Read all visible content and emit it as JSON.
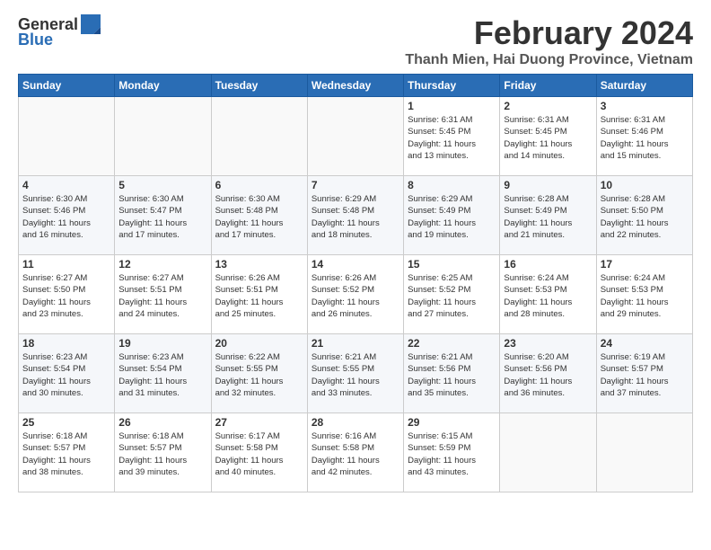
{
  "logo": {
    "text_general": "General",
    "text_blue": "Blue"
  },
  "header": {
    "title": "February 2024",
    "location": "Thanh Mien, Hai Duong Province, Vietnam"
  },
  "columns": [
    "Sunday",
    "Monday",
    "Tuesday",
    "Wednesday",
    "Thursday",
    "Friday",
    "Saturday"
  ],
  "weeks": [
    [
      {
        "day": "",
        "info": ""
      },
      {
        "day": "",
        "info": ""
      },
      {
        "day": "",
        "info": ""
      },
      {
        "day": "",
        "info": ""
      },
      {
        "day": "1",
        "info": "Sunrise: 6:31 AM\nSunset: 5:45 PM\nDaylight: 11 hours\nand 13 minutes."
      },
      {
        "day": "2",
        "info": "Sunrise: 6:31 AM\nSunset: 5:45 PM\nDaylight: 11 hours\nand 14 minutes."
      },
      {
        "day": "3",
        "info": "Sunrise: 6:31 AM\nSunset: 5:46 PM\nDaylight: 11 hours\nand 15 minutes."
      }
    ],
    [
      {
        "day": "4",
        "info": "Sunrise: 6:30 AM\nSunset: 5:46 PM\nDaylight: 11 hours\nand 16 minutes."
      },
      {
        "day": "5",
        "info": "Sunrise: 6:30 AM\nSunset: 5:47 PM\nDaylight: 11 hours\nand 17 minutes."
      },
      {
        "day": "6",
        "info": "Sunrise: 6:30 AM\nSunset: 5:48 PM\nDaylight: 11 hours\nand 17 minutes."
      },
      {
        "day": "7",
        "info": "Sunrise: 6:29 AM\nSunset: 5:48 PM\nDaylight: 11 hours\nand 18 minutes."
      },
      {
        "day": "8",
        "info": "Sunrise: 6:29 AM\nSunset: 5:49 PM\nDaylight: 11 hours\nand 19 minutes."
      },
      {
        "day": "9",
        "info": "Sunrise: 6:28 AM\nSunset: 5:49 PM\nDaylight: 11 hours\nand 21 minutes."
      },
      {
        "day": "10",
        "info": "Sunrise: 6:28 AM\nSunset: 5:50 PM\nDaylight: 11 hours\nand 22 minutes."
      }
    ],
    [
      {
        "day": "11",
        "info": "Sunrise: 6:27 AM\nSunset: 5:50 PM\nDaylight: 11 hours\nand 23 minutes."
      },
      {
        "day": "12",
        "info": "Sunrise: 6:27 AM\nSunset: 5:51 PM\nDaylight: 11 hours\nand 24 minutes."
      },
      {
        "day": "13",
        "info": "Sunrise: 6:26 AM\nSunset: 5:51 PM\nDaylight: 11 hours\nand 25 minutes."
      },
      {
        "day": "14",
        "info": "Sunrise: 6:26 AM\nSunset: 5:52 PM\nDaylight: 11 hours\nand 26 minutes."
      },
      {
        "day": "15",
        "info": "Sunrise: 6:25 AM\nSunset: 5:52 PM\nDaylight: 11 hours\nand 27 minutes."
      },
      {
        "day": "16",
        "info": "Sunrise: 6:24 AM\nSunset: 5:53 PM\nDaylight: 11 hours\nand 28 minutes."
      },
      {
        "day": "17",
        "info": "Sunrise: 6:24 AM\nSunset: 5:53 PM\nDaylight: 11 hours\nand 29 minutes."
      }
    ],
    [
      {
        "day": "18",
        "info": "Sunrise: 6:23 AM\nSunset: 5:54 PM\nDaylight: 11 hours\nand 30 minutes."
      },
      {
        "day": "19",
        "info": "Sunrise: 6:23 AM\nSunset: 5:54 PM\nDaylight: 11 hours\nand 31 minutes."
      },
      {
        "day": "20",
        "info": "Sunrise: 6:22 AM\nSunset: 5:55 PM\nDaylight: 11 hours\nand 32 minutes."
      },
      {
        "day": "21",
        "info": "Sunrise: 6:21 AM\nSunset: 5:55 PM\nDaylight: 11 hours\nand 33 minutes."
      },
      {
        "day": "22",
        "info": "Sunrise: 6:21 AM\nSunset: 5:56 PM\nDaylight: 11 hours\nand 35 minutes."
      },
      {
        "day": "23",
        "info": "Sunrise: 6:20 AM\nSunset: 5:56 PM\nDaylight: 11 hours\nand 36 minutes."
      },
      {
        "day": "24",
        "info": "Sunrise: 6:19 AM\nSunset: 5:57 PM\nDaylight: 11 hours\nand 37 minutes."
      }
    ],
    [
      {
        "day": "25",
        "info": "Sunrise: 6:18 AM\nSunset: 5:57 PM\nDaylight: 11 hours\nand 38 minutes."
      },
      {
        "day": "26",
        "info": "Sunrise: 6:18 AM\nSunset: 5:57 PM\nDaylight: 11 hours\nand 39 minutes."
      },
      {
        "day": "27",
        "info": "Sunrise: 6:17 AM\nSunset: 5:58 PM\nDaylight: 11 hours\nand 40 minutes."
      },
      {
        "day": "28",
        "info": "Sunrise: 6:16 AM\nSunset: 5:58 PM\nDaylight: 11 hours\nand 42 minutes."
      },
      {
        "day": "29",
        "info": "Sunrise: 6:15 AM\nSunset: 5:59 PM\nDaylight: 11 hours\nand 43 minutes."
      },
      {
        "day": "",
        "info": ""
      },
      {
        "day": "",
        "info": ""
      }
    ]
  ]
}
